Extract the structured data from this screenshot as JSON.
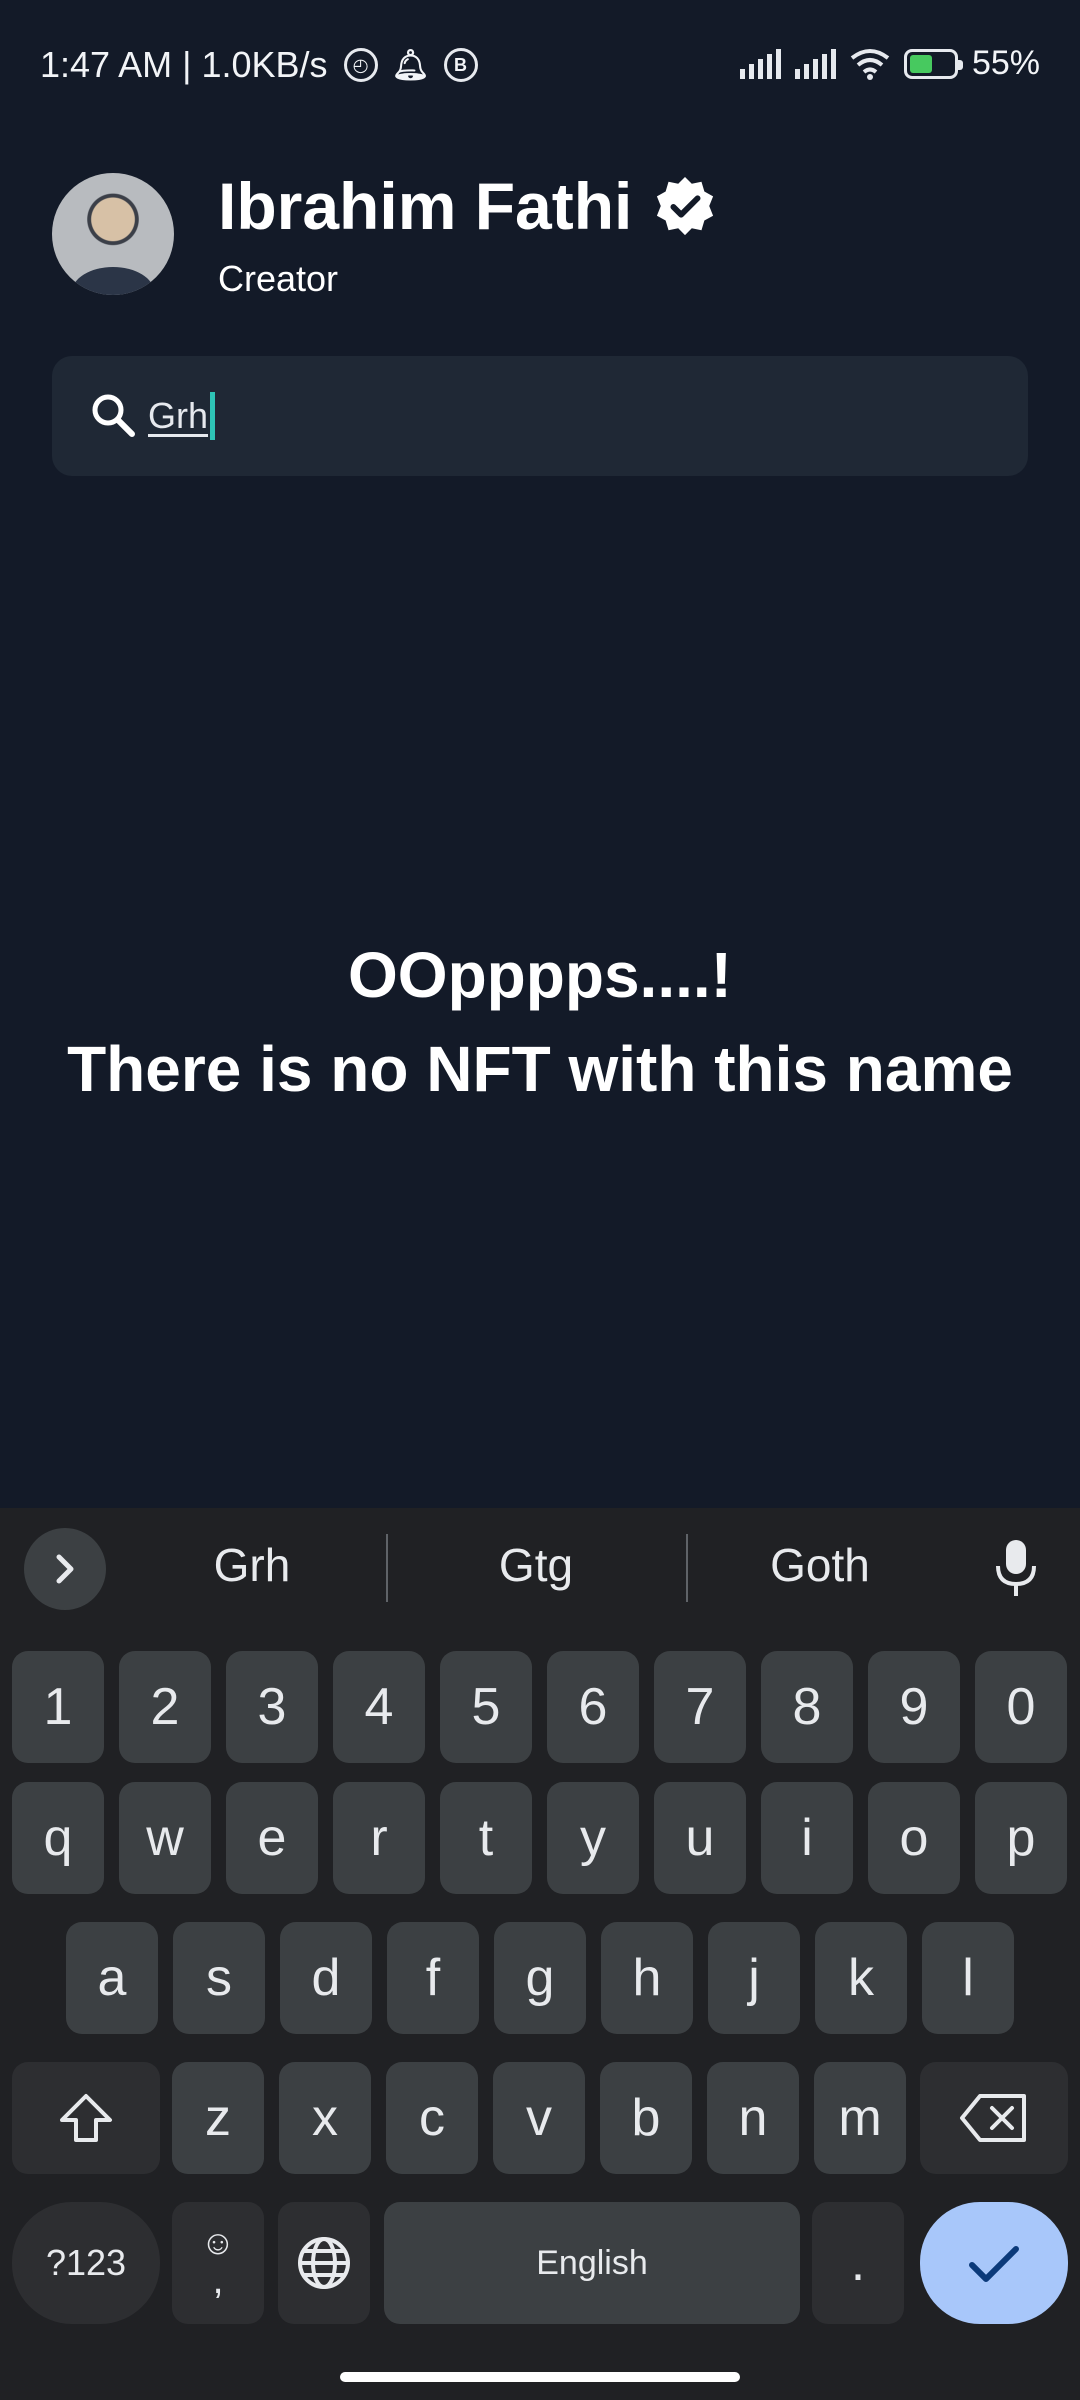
{
  "status_bar": {
    "left_text": "1:47 AM | 1.0KB/s",
    "battery_text": "55%",
    "battery_level": 0.55
  },
  "profile": {
    "name": "Ibrahim Fathi",
    "role": "Creator",
    "verified": true
  },
  "search": {
    "value": "Grh"
  },
  "empty_state": {
    "line1": "OOpppps....!",
    "line2": "There is no NFT with this name"
  },
  "keyboard": {
    "suggestions": [
      "Grh",
      "Gtg",
      "Goth"
    ],
    "row_numbers": [
      "1",
      "2",
      "3",
      "4",
      "5",
      "6",
      "7",
      "8",
      "9",
      "0"
    ],
    "row_top": [
      "q",
      "w",
      "e",
      "r",
      "t",
      "y",
      "u",
      "i",
      "o",
      "p"
    ],
    "row_middle": [
      "a",
      "s",
      "d",
      "f",
      "g",
      "h",
      "j",
      "k",
      "l"
    ],
    "row_bottom": [
      "z",
      "x",
      "c",
      "v",
      "b",
      "n",
      "m"
    ],
    "symbols_label": "?123",
    "comma_label": ",",
    "space_label": "English",
    "period_label": "."
  },
  "colors": {
    "background": "#131a28",
    "search_bg": "#1f2835",
    "cursor": "#2ec4b6",
    "keyboard_bg": "#202124",
    "key_bg": "#3c4043",
    "done_key": "#a8c7fa"
  }
}
